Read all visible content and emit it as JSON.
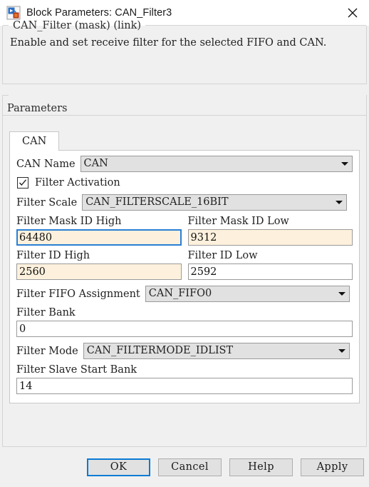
{
  "titlebar": {
    "icon": "simulink-block-icon",
    "title": "Block Parameters: CAN_Filter3",
    "close_icon": "close-icon"
  },
  "description": {
    "legend": "CAN_Filter (mask) (link)",
    "text": "Enable and set receive filter for the selected FIFO and CAN."
  },
  "parameters": {
    "legend": "Parameters",
    "tabs": [
      {
        "label": "CAN",
        "selected": true
      }
    ],
    "can_name": {
      "label": "CAN Name",
      "value": "CAN",
      "arrow_icon": "chevron-down-icon"
    },
    "filter_activation": {
      "label": "Filter Activation",
      "checked": true,
      "check_icon": "checkmark-icon"
    },
    "filter_scale": {
      "label": "Filter Scale",
      "value": "CAN_FILTERSCALE_16BIT",
      "arrow_icon": "chevron-down-icon"
    },
    "filter_mask_id_high": {
      "label": "Filter Mask ID High",
      "value": "64480",
      "focused": true
    },
    "filter_mask_id_low": {
      "label": "Filter Mask ID Low",
      "value": "9312",
      "focused": false
    },
    "filter_id_high": {
      "label": "Filter ID High",
      "value": "2560",
      "focused": false
    },
    "filter_id_low": {
      "label": "Filter ID Low",
      "value": "2592",
      "focused": false
    },
    "filter_fifo_assignment": {
      "label": "Filter FIFO Assignment",
      "value": "CAN_FIFO0",
      "arrow_icon": "chevron-down-icon"
    },
    "filter_bank": {
      "label": "Filter Bank",
      "value": "0"
    },
    "filter_mode": {
      "label": "Filter Mode",
      "value": "CAN_FILTERMODE_IDLIST",
      "arrow_icon": "chevron-down-icon"
    },
    "filter_slave_start_bank": {
      "label": "Filter Slave Start Bank",
      "value": "14"
    }
  },
  "buttons": {
    "ok": "OK",
    "cancel": "Cancel",
    "help": "Help",
    "apply": "Apply"
  },
  "colors": {
    "accent": "#0a7bd4",
    "edited_field_bg": "#fdf1dd",
    "window_bg": "#f0f0f0",
    "panel_bg": "#ffffff"
  }
}
